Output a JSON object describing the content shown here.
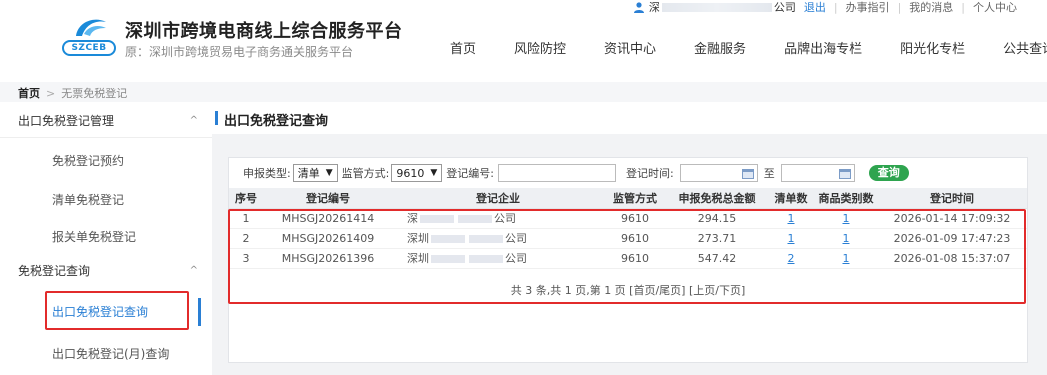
{
  "header": {
    "logo_text": "SZCEB",
    "title": "深圳市跨境电商线上综合服务平台",
    "subtitle": "原：深圳市跨境贸易电子商务通关服务平台",
    "user": {
      "prefix": "深",
      "suffix": "公司"
    },
    "top_links": [
      "退出",
      "办事指引",
      "我的消息",
      "个人中心"
    ],
    "nav": [
      "首页",
      "风险防控",
      "资讯中心",
      "金融服务",
      "品牌出海专栏",
      "阳光化专栏",
      "公共查询"
    ]
  },
  "breadcrumb": {
    "home": "首页",
    "separator": ">",
    "current": "无票免税登记"
  },
  "sidebar": {
    "group1": "出口免税登记管理",
    "items1": [
      "免税登记预约",
      "清单免税登记",
      "报关单免税登记"
    ],
    "group2": "免税登记查询",
    "items2": [
      "出口免税登记查询",
      "出口免税登记(月)查询"
    ]
  },
  "main": {
    "title": "出口免税登记查询",
    "search": {
      "decl_type_label": "申报类型:",
      "decl_type_value": "清单",
      "supervision_label": "监管方式:",
      "supervision_value": "9610",
      "reg_no_label": "登记编号:",
      "reg_time_label": "登记时间:",
      "to_label": "至",
      "query_button": "查询"
    },
    "columns": [
      "序号",
      "登记编号",
      "登记企业",
      "监管方式",
      "申报免税总金额",
      "清单数",
      "商品类别数",
      "登记时间"
    ],
    "rows": [
      {
        "no": "1",
        "reg_no": "MHSGJ20261414",
        "ent_prefix": "深",
        "ent_suffix": "公司",
        "mode": "9610",
        "amount": "294.15",
        "lists": "1",
        "categories": "1",
        "time": "2026-01-14 17:09:32"
      },
      {
        "no": "2",
        "reg_no": "MHSGJ20261409",
        "ent_prefix": "深圳",
        "ent_suffix": "公司",
        "mode": "9610",
        "amount": "273.71",
        "lists": "1",
        "categories": "1",
        "time": "2026-01-09 17:47:23"
      },
      {
        "no": "3",
        "reg_no": "MHSGJ20261396",
        "ent_prefix": "深圳",
        "ent_suffix": "公司",
        "mode": "9610",
        "amount": "547.42",
        "lists": "2",
        "categories": "1",
        "time": "2026-01-08 15:37:07"
      }
    ],
    "pager": "共 3 条,共 1 页,第 1 页 [首页/尾页] [上页/下页]"
  },
  "colors": {
    "accent": "#2a7fd4",
    "highlight": "#e22b2b",
    "query_button": "#2ea44f"
  }
}
